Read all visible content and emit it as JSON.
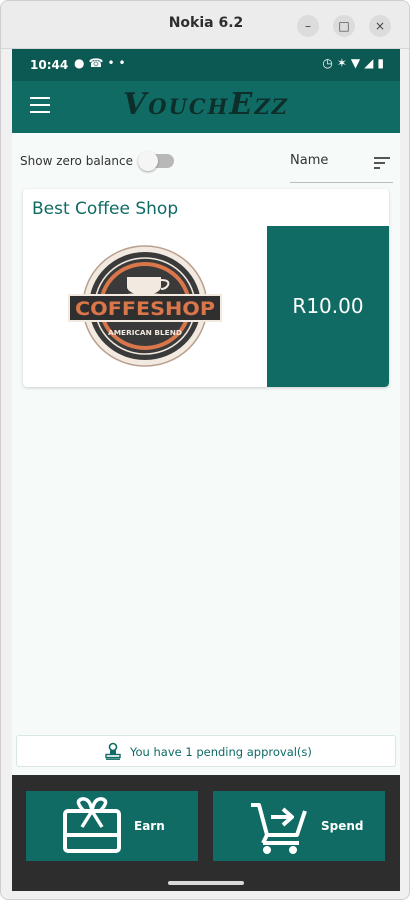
{
  "window": {
    "title": "Nokia 6.2",
    "minimize_glyph": "–",
    "maximize_glyph": "□",
    "close_glyph": "×"
  },
  "status_bar": {
    "time": "10:44",
    "left_icons": [
      "chat-bubble-icon",
      "whatsapp-icon",
      "more-icon"
    ],
    "right_icons": [
      "alarm-icon",
      "bluetooth-icon",
      "wifi-icon",
      "signal-icon",
      "battery-icon"
    ]
  },
  "app_bar": {
    "logo": "VouchEzz",
    "menu_icon": "hamburger-icon"
  },
  "filters": {
    "show_zero_balance_label": "Show zero balance",
    "show_zero_balance": false,
    "sort_value": "Name",
    "sort_icon": "sort-icon"
  },
  "vouchers": [
    {
      "shop_name": "Best Coffee Shop",
      "amount": "R10.00",
      "logo_alt": "COFFESHOP",
      "logo_tagline": "AMERICAN BLEND"
    }
  ],
  "pending": {
    "text": "You have 1 pending approval(s)",
    "icon": "person-stamp-icon"
  },
  "actions": {
    "earn_label": "Earn",
    "earn_icon": "gift-card-icon",
    "spend_label": "Spend",
    "spend_icon": "cart-arrow-icon"
  },
  "colors": {
    "primary": "#0f6b64",
    "status_bar": "#0c5852",
    "bottom_bar": "#2d2d2d",
    "background": "#f6fbfa",
    "logo_ink": "#0d2f2c",
    "coffee_orange": "#d9764a"
  }
}
